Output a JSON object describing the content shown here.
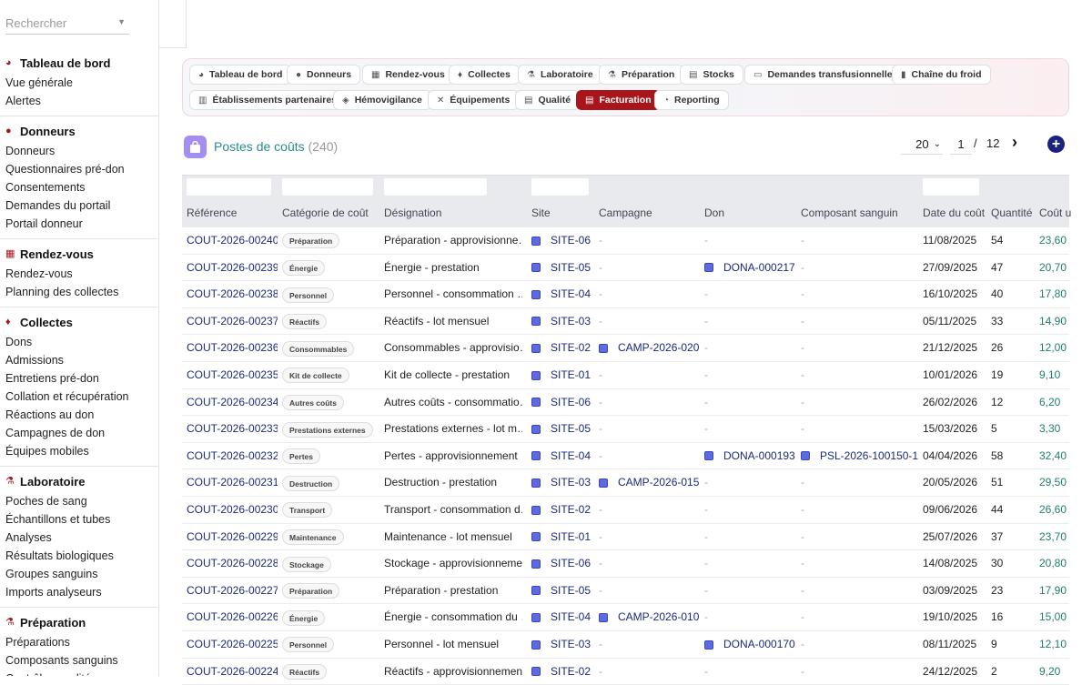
{
  "search": {
    "placeholder": "Rechercher"
  },
  "sidebar": {
    "sections": [
      {
        "title": "Tableau de bord",
        "icon": "dashboard-icon",
        "items": [
          "Vue générale",
          "Alertes"
        ]
      },
      {
        "title": "Donneurs",
        "icon": "person-icon",
        "items": [
          "Donneurs",
          "Questionnaires pré-don",
          "Consentements",
          "Demandes du portail",
          "Portail donneur"
        ]
      },
      {
        "title": "Rendez-vous",
        "icon": "calendar-icon",
        "items": [
          "Rendez-vous",
          "Planning des collectes"
        ]
      },
      {
        "title": "Collectes",
        "icon": "drop-icon",
        "items": [
          "Dons",
          "Admissions",
          "Entretiens pré-don",
          "Collation et récupération",
          "Réactions au don",
          "Campagnes de don",
          "Équipes mobiles"
        ]
      },
      {
        "title": "Laboratoire",
        "icon": "microscope-icon",
        "items": [
          "Poches de sang",
          "Échantillons et tubes",
          "Analyses",
          "Résultats biologiques",
          "Groupes sanguins",
          "Imports analyseurs"
        ]
      },
      {
        "title": "Préparation",
        "icon": "flask-icon",
        "items": [
          "Préparations",
          "Composants sanguins",
          "Contrôles qualité"
        ]
      }
    ]
  },
  "nav": [
    {
      "label": "Tableau de bord",
      "icon": "dashboard-icon"
    },
    {
      "label": "Donneurs",
      "icon": "person-icon"
    },
    {
      "label": "Rendez-vous",
      "icon": "calendar-icon"
    },
    {
      "label": "Collectes",
      "icon": "drop-icon"
    },
    {
      "label": "Laboratoire",
      "icon": "microscope-icon"
    },
    {
      "label": "Préparation",
      "icon": "flask-icon"
    },
    {
      "label": "Stocks",
      "icon": "warehouse-icon"
    },
    {
      "label": "Demandes transfusionnelles",
      "icon": "document-icon"
    },
    {
      "label": "Chaîne du froid",
      "icon": "thermometer-icon"
    },
    {
      "label": "Établissements partenaires",
      "icon": "building-icon"
    },
    {
      "label": "Hémovigilance",
      "icon": "shield-icon"
    },
    {
      "label": "Équipements",
      "icon": "tools-icon"
    },
    {
      "label": "Qualité",
      "icon": "clipboard-icon"
    },
    {
      "label": "Facturation",
      "icon": "invoice-icon",
      "active": true
    },
    {
      "label": "Reporting",
      "icon": "chart-icon"
    }
  ],
  "header": {
    "title": "Postes de coûts",
    "count": "(240)",
    "page_size": "20",
    "page": "1",
    "separator": "/",
    "total_pages": "12",
    "next_icon": "chevron-right-icon",
    "add_icon": "plus-icon"
  },
  "columns": [
    "Référence",
    "Catégorie de coût",
    "Désignation",
    "Site",
    "Campagne",
    "Don",
    "Composant sanguin",
    "Date du coût",
    "Quantité",
    "Coût u"
  ],
  "rows": [
    {
      "ref": "COUT-2026-00240",
      "cat": "Préparation",
      "des": "Préparation - approvisionne…",
      "site": "SITE-06",
      "camp": "-",
      "don": "-",
      "comp": "-",
      "date": "11/08/2025",
      "qty": "54",
      "cost": "23,60"
    },
    {
      "ref": "COUT-2026-00239",
      "cat": "Énergie",
      "des": "Énergie - prestation",
      "site": "SITE-05",
      "camp": "-",
      "don": "DONA-000217",
      "comp": "-",
      "date": "27/09/2025",
      "qty": "47",
      "cost": "20,70"
    },
    {
      "ref": "COUT-2026-00238",
      "cat": "Personnel",
      "des": "Personnel - consommation …",
      "site": "SITE-04",
      "camp": "-",
      "don": "-",
      "comp": "-",
      "date": "16/10/2025",
      "qty": "40",
      "cost": "17,80"
    },
    {
      "ref": "COUT-2026-00237",
      "cat": "Réactifs",
      "des": "Réactifs - lot mensuel",
      "site": "SITE-03",
      "camp": "-",
      "don": "-",
      "comp": "-",
      "date": "05/11/2025",
      "qty": "33",
      "cost": "14,90"
    },
    {
      "ref": "COUT-2026-00236",
      "cat": "Consommables",
      "des": "Consommables - approvisio…",
      "site": "SITE-02",
      "camp": "CAMP-2026-020",
      "don": "-",
      "comp": "-",
      "date": "21/12/2025",
      "qty": "26",
      "cost": "12,00"
    },
    {
      "ref": "COUT-2026-00235",
      "cat": "Kit de collecte",
      "des": "Kit de collecte - prestation",
      "site": "SITE-01",
      "camp": "-",
      "don": "-",
      "comp": "-",
      "date": "10/01/2026",
      "qty": "19",
      "cost": "9,10"
    },
    {
      "ref": "COUT-2026-00234",
      "cat": "Autres coûts",
      "des": "Autres coûts - consommatio…",
      "site": "SITE-06",
      "camp": "-",
      "don": "-",
      "comp": "-",
      "date": "26/02/2026",
      "qty": "12",
      "cost": "6,20"
    },
    {
      "ref": "COUT-2026-00233",
      "cat": "Prestations externes",
      "des": "Prestations externes - lot m…",
      "site": "SITE-05",
      "camp": "-",
      "don": "-",
      "comp": "-",
      "date": "15/03/2026",
      "qty": "5",
      "cost": "3,30"
    },
    {
      "ref": "COUT-2026-00232",
      "cat": "Pertes",
      "des": "Pertes - approvisionnement",
      "site": "SITE-04",
      "camp": "-",
      "don": "DONA-000193",
      "comp": "PSL-2026-100150-1",
      "date": "04/04/2026",
      "qty": "58",
      "cost": "32,40"
    },
    {
      "ref": "COUT-2026-00231",
      "cat": "Destruction",
      "des": "Destruction - prestation",
      "site": "SITE-03",
      "camp": "CAMP-2026-015",
      "don": "-",
      "comp": "-",
      "date": "20/05/2026",
      "qty": "51",
      "cost": "29,50"
    },
    {
      "ref": "COUT-2026-00230",
      "cat": "Transport",
      "des": "Transport - consommation d…",
      "site": "SITE-02",
      "camp": "-",
      "don": "-",
      "comp": "-",
      "date": "09/06/2026",
      "qty": "44",
      "cost": "26,60"
    },
    {
      "ref": "COUT-2026-00229",
      "cat": "Maintenance",
      "des": "Maintenance - lot mensuel",
      "site": "SITE-01",
      "camp": "-",
      "don": "-",
      "comp": "-",
      "date": "25/07/2026",
      "qty": "37",
      "cost": "23,70"
    },
    {
      "ref": "COUT-2026-00228",
      "cat": "Stockage",
      "des": "Stockage - approvisionnement",
      "site": "SITE-06",
      "camp": "-",
      "don": "-",
      "comp": "-",
      "date": "14/08/2025",
      "qty": "30",
      "cost": "20,80"
    },
    {
      "ref": "COUT-2026-00227",
      "cat": "Préparation",
      "des": "Préparation - prestation",
      "site": "SITE-05",
      "camp": "-",
      "don": "-",
      "comp": "-",
      "date": "03/09/2025",
      "qty": "23",
      "cost": "17,90"
    },
    {
      "ref": "COUT-2026-00226",
      "cat": "Énergie",
      "des": "Énergie - consommation du …",
      "site": "SITE-04",
      "camp": "CAMP-2026-010",
      "don": "-",
      "comp": "-",
      "date": "19/10/2025",
      "qty": "16",
      "cost": "15,00"
    },
    {
      "ref": "COUT-2026-00225",
      "cat": "Personnel",
      "des": "Personnel - lot mensuel",
      "site": "SITE-03",
      "camp": "-",
      "don": "DONA-000170",
      "comp": "-",
      "date": "08/11/2025",
      "qty": "9",
      "cost": "12,10"
    },
    {
      "ref": "COUT-2026-00224",
      "cat": "Réactifs",
      "des": "Réactifs - approvisionnement",
      "site": "SITE-02",
      "camp": "-",
      "don": "-",
      "comp": "-",
      "date": "24/12/2025",
      "qty": "2",
      "cost": "9,20"
    }
  ],
  "colors": {
    "accent": "#a8161c",
    "link": "#1a2a7c",
    "title": "#2a8c8a",
    "cost": "#1f7f6e",
    "header_bg": "#e9eaee"
  }
}
